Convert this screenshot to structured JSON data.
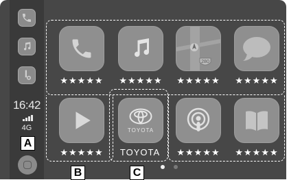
{
  "status": {
    "time": "16:42",
    "network": "4G"
  },
  "callouts": {
    "a": "A",
    "b": "B",
    "c": "C"
  },
  "apps": [
    {
      "icon": "phone-icon",
      "label": "★★★★★"
    },
    {
      "icon": "music-icon",
      "label": "★★★★★"
    },
    {
      "icon": "maps-icon",
      "label": "★★★★★"
    },
    {
      "icon": "messages-icon",
      "label": "★★★★★"
    },
    {
      "icon": "play-icon",
      "label": "★★★★★"
    },
    {
      "icon": "toyota-icon",
      "label": "TOYOTA",
      "logo_text": "TOYOTA"
    },
    {
      "icon": "podcasts-icon",
      "label": "★★★★★"
    },
    {
      "icon": "books-icon",
      "label": "★★★★★"
    }
  ],
  "maps_shield": "280",
  "page_indicator": {
    "current": 1,
    "total": 2
  },
  "colors": {
    "background": "#474747",
    "rail": "#3a3a3a",
    "tile": "#8f8f8f",
    "frame": "#ffffff"
  }
}
